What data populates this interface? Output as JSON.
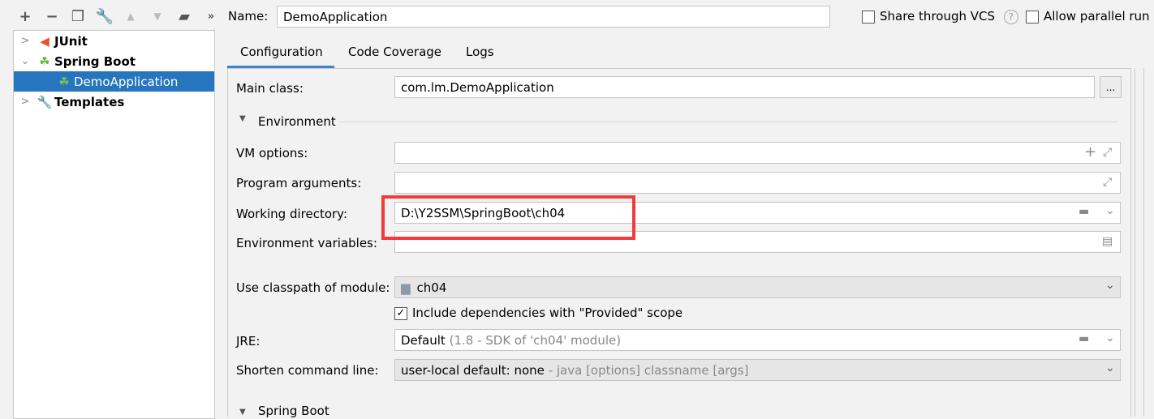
{
  "toolbar": {
    "items": [
      {
        "name": "add-icon",
        "glyph": "+"
      },
      {
        "name": "remove-icon",
        "glyph": "−"
      },
      {
        "name": "copy-icon",
        "glyph": "❐"
      },
      {
        "name": "wrench-icon",
        "glyph": "🔧"
      },
      {
        "name": "move-up-icon",
        "glyph": "▲"
      },
      {
        "name": "move-down-icon",
        "glyph": "▼"
      },
      {
        "name": "new-folder-icon",
        "glyph": "▰"
      },
      {
        "name": "more-icon",
        "glyph": "»"
      }
    ]
  },
  "tree": {
    "items": [
      {
        "label": "JUnit",
        "expanded": false
      },
      {
        "label": "Spring Boot",
        "expanded": true
      },
      {
        "label": "DemoApplication",
        "selected": true
      },
      {
        "label": "Templates",
        "expanded": false
      }
    ]
  },
  "header": {
    "name_label": "Name:",
    "name_value": "DemoApplication",
    "share_vcs": "Share through VCS",
    "parallel_run": "Allow parallel run",
    "help": "?"
  },
  "tabs": [
    {
      "label": "Configuration",
      "active": true
    },
    {
      "label": "Code Coverage"
    },
    {
      "label": "Logs"
    }
  ],
  "form": {
    "main_class_label": "Main class:",
    "main_class_value": "com.lm.DemoApplication",
    "browse": "...",
    "environment_label": "Environment",
    "vm_options_label": "VM options:",
    "vm_options_value": "",
    "program_args_label": "Program arguments:",
    "program_args_value": "",
    "working_dir_label": "Working directory:",
    "working_dir_value": "D:\\Y2SSM\\SpringBoot\\ch04",
    "env_vars_label": "Environment variables:",
    "env_vars_value": "",
    "classpath_label": "Use classpath of module:",
    "classpath_value": "ch04",
    "include_deps_label": "Include dependencies with \"Provided\" scope",
    "include_deps_checked": true,
    "jre_label": "JRE:",
    "jre_value": "Default",
    "jre_hint": "(1.8 - SDK of 'ch04' module)",
    "shorten_label": "Shorten command line:",
    "shorten_value": "user-local default: none",
    "shorten_hint": "- java [options] classname [args]",
    "spring_boot_section": "Spring Boot"
  },
  "colors": {
    "selection": "#2675bf",
    "tab_underline": "#4083c9",
    "highlight_box": "#f03c3c"
  }
}
